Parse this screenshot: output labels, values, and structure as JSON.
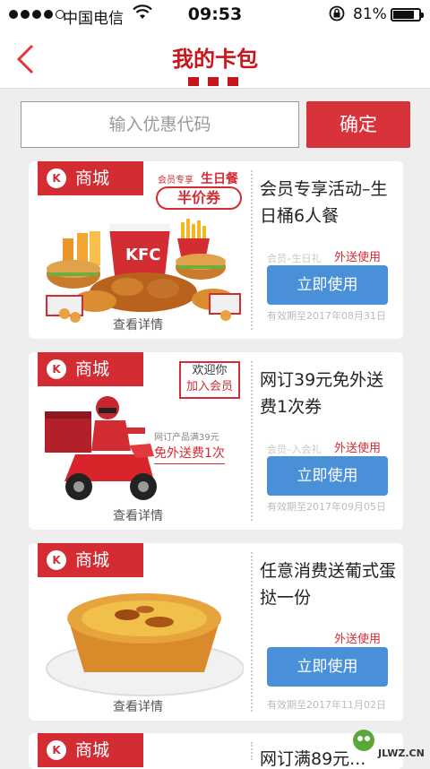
{
  "status_bar": {
    "carrier": "中国电信",
    "time": "09:53",
    "battery": "81%",
    "battery_level": 0.81
  },
  "nav": {
    "title": "我的卡包"
  },
  "promo": {
    "placeholder": "输入优惠代码",
    "confirm_label": "确定"
  },
  "coupons": [
    {
      "tag": "商城",
      "badge_small": "会员专享",
      "badge_big": "生日餐",
      "badge_label": "半价券",
      "title": "会员专享活动–生日桶6人餐",
      "sub": "会员–生日礼",
      "delivery": "外送使用",
      "button": "立即使用",
      "expire": "有效期至2017年08月31日",
      "detail": "查看详情"
    },
    {
      "tag": "商城",
      "badge_line1": "欢迎你",
      "badge_line2": "加入会员",
      "promo_small": "网订产品满39元",
      "promo_big": "免外送费1次",
      "title": "网订39元免外送费1次券",
      "sub": "会员–入会礼",
      "delivery": "外送使用",
      "button": "立即使用",
      "expire": "有效期至2017年09月05日",
      "detail": "查看详情"
    },
    {
      "tag": "商城",
      "title": "任意消费送葡式蛋挞一份",
      "delivery": "外送使用",
      "button": "立即使用",
      "expire": "有效期至2017年11月02日",
      "detail": "查看详情"
    },
    {
      "tag": "商城",
      "title": "网订满89元..."
    }
  ],
  "watermark": "JLWZ.CN",
  "colors": {
    "kfc_red": "#d42c33",
    "title_red": "#c8161d",
    "use_blue": "#4a90d9"
  },
  "icons": {
    "back": "chevron-left-icon",
    "wifi": "wifi-icon",
    "lock": "rotation-lock-icon",
    "logo": "kfc-logo-icon"
  }
}
